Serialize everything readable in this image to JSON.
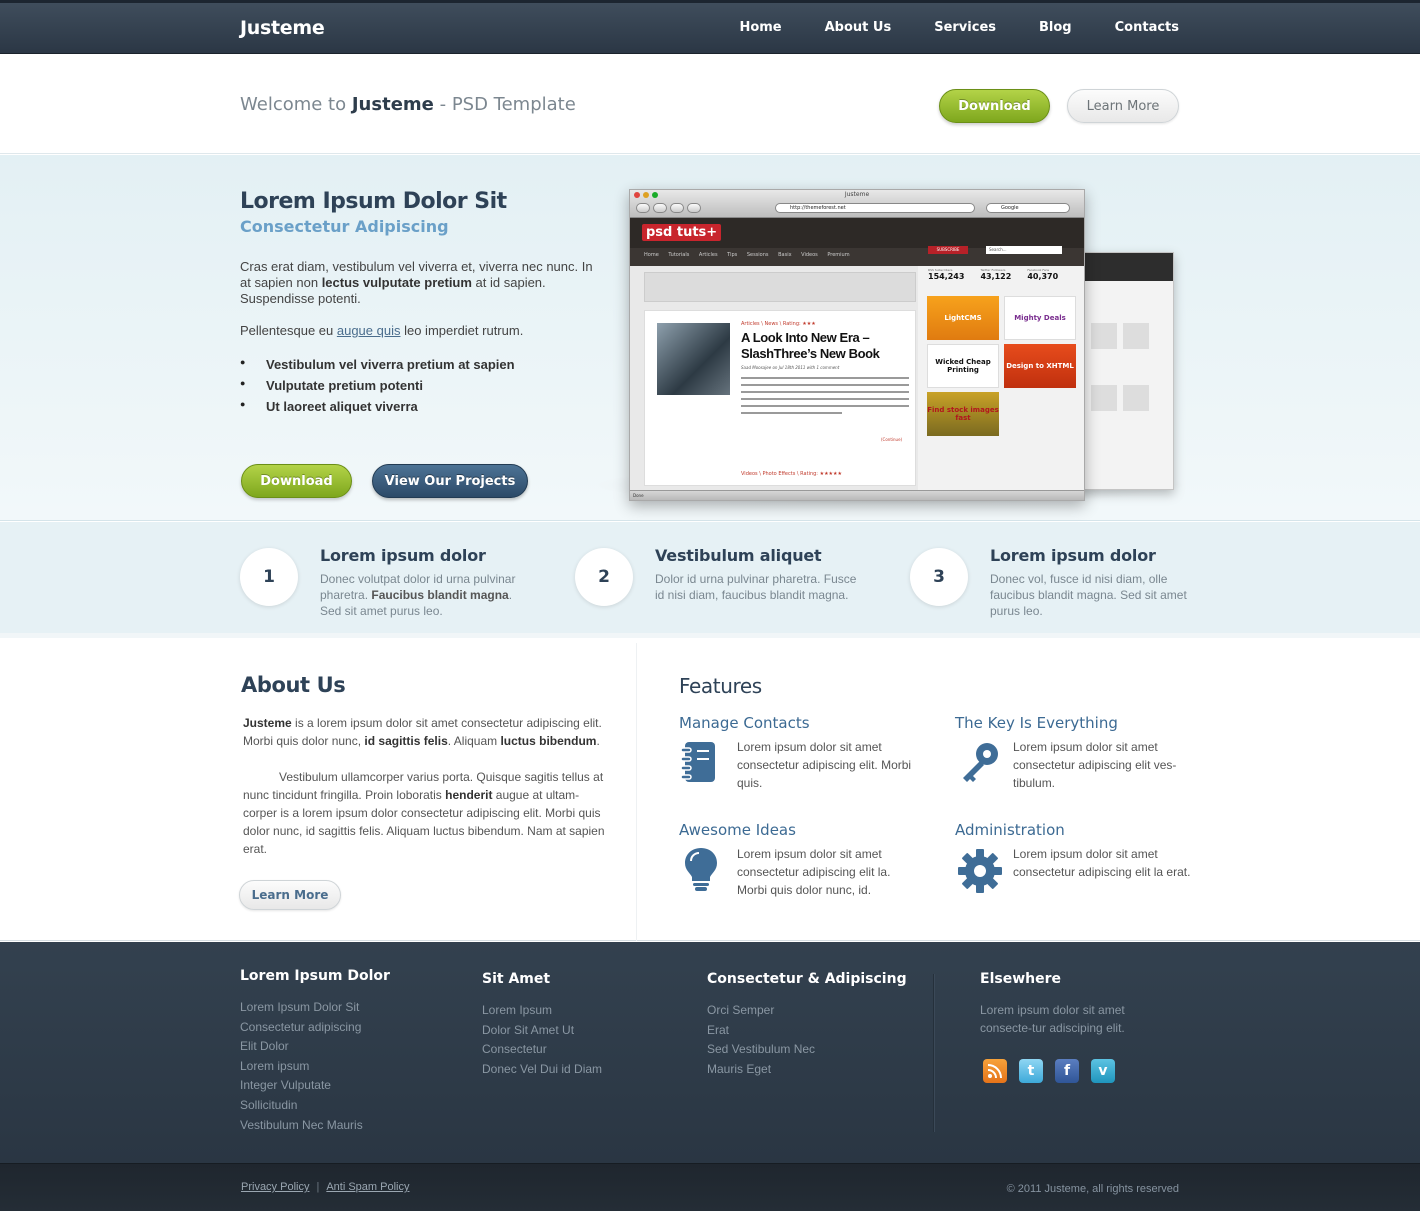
{
  "header": {
    "logo": "Justeme",
    "nav": [
      "Home",
      "About Us",
      "Services",
      "Blog",
      "Contacts"
    ]
  },
  "welcome": {
    "prefix": "Welcome to ",
    "brand": "Justeme",
    "suffix": " - PSD Template",
    "download_label": "Download",
    "learn_more_label": "Learn More"
  },
  "hero": {
    "title": "Lorem Ipsum Dolor Sit",
    "subtitle": "Consectetur Adipiscing",
    "para1_a": "Cras erat diam, vestibulum vel viverra et, viverra nec nunc. In at sapien non ",
    "para1_bold": "lectus vulputate pretium",
    "para1_b": " at id sapien. Suspendisse potenti.",
    "para2_a": "Pellentesque eu ",
    "para2_link": "augue quis",
    "para2_b": " leo imperdiet rutrum.",
    "bullets": [
      "Vestibulum vel viverra pretium at sapien",
      "Vulputate pretium potenti",
      "Ut laoreet aliquet viverra"
    ],
    "download_label": "Download",
    "projects_label": "View Our Projects",
    "mockup": {
      "window_title": "Justeme",
      "url": "http://themeforest.net",
      "search_engine": "Google",
      "site_logo": "psd tuts+",
      "menu": "Home Tutorials Articles Tips Sessions Basix Videos Premium",
      "subscribe": "SUBSCRIBE",
      "search_placeholder": "Search...",
      "stats": [
        {
          "label": "RSS Subscribers",
          "value": "154,243"
        },
        {
          "label": "Twitter Followers",
          "value": "43,122"
        },
        {
          "label": "Facebook Fans",
          "value": "40,370"
        }
      ],
      "article_meta": "Articles \\ News \\ Rating: ★★★",
      "article_title": "A Look Into New Era – SlashThree’s New Book",
      "article_byline": "Saad Moosajee on Jul 18th 2011 with 1 comment",
      "continue": "(Continue)",
      "article2_meta": "Videos \\ Photo Effects \\ Rating: ★★★★★",
      "ads": [
        "LightCMS",
        "Mighty Deals",
        "Wicked Cheap Printing",
        "Design to XHTML",
        "Find stock images fast"
      ],
      "status": "Done"
    }
  },
  "steps": [
    {
      "num": "1",
      "title": "Lorem ipsum dolor",
      "text_a": "Donec volutpat dolor id urna pulvinar pharetra. ",
      "text_bold": "Faucibus blandit magna",
      "text_b": ". Sed sit amet purus leo."
    },
    {
      "num": "2",
      "title": "Vestibulum aliquet",
      "text_a": "Dolor id urna pulvinar pharetra. Fusce id nisi diam, faucibus blandit magna.",
      "text_bold": "",
      "text_b": ""
    },
    {
      "num": "3",
      "title": "Lorem ipsum dolor",
      "text_a": "Donec vol, fusce id nisi diam, olle faucibus blandit magna. Sed sit amet purus leo.",
      "text_bold": "",
      "text_b": ""
    }
  ],
  "about": {
    "title": "About Us",
    "p1_b1": "Justeme",
    "p1_a": " is a lorem ipsum dolor sit amet consectetur adipiscing elit. Morbi quis dolor nunc, ",
    "p1_b2": "id sagittis felis",
    "p1_c": ". Aliquam ",
    "p1_b3": "luctus bibendum",
    "p1_d": ".",
    "p2_a": "Vestibulum ullamcorper varius porta. Quisque sagitis tellus at nunc tincidunt fringilla. Proin loboratis ",
    "p2_b": "henderit",
    "p2_c": " augue at ultam-corper is a lorem ipsum dolor consectetur adipiscing elit. Morbi quis dolor nunc, id sagittis felis. Aliquam luctus bibendum. Nam at sapien erat.",
    "learn_more_label": "Learn More"
  },
  "features": {
    "title": "Features",
    "items": [
      {
        "title": "Manage Contacts",
        "icon": "notebook-icon",
        "text": "Lorem ipsum dolor sit amet consectetur adipiscing elit. Morbi quis."
      },
      {
        "title": "The Key Is Everything",
        "icon": "key-icon",
        "text": "Lorem ipsum dolor sit amet consectetur adipiscing elit ves-tibulum."
      },
      {
        "title": "Awesome Ideas",
        "icon": "lightbulb-icon",
        "text": "Lorem ipsum dolor sit amet consectetur adipiscing elit la. Morbi quis dolor nunc, id."
      },
      {
        "title": "Administration",
        "icon": "gear-icon",
        "text": "Lorem ipsum dolor sit amet consectetur adipiscing elit la erat."
      }
    ]
  },
  "footer": {
    "col1": {
      "title": "Lorem Ipsum Dolor",
      "links": [
        "Lorem Ipsum Dolor Sit",
        "Consectetur adipiscing",
        "Elit Dolor",
        "Lorem ipsum",
        "Integer Vulputate",
        "Sollicitudin",
        "Vestibulum Nec Mauris"
      ]
    },
    "col2": {
      "title": "Sit Amet",
      "links": [
        "Lorem Ipsum",
        "Dolor Sit Amet Ut",
        "Consectetur",
        "Donec Vel Dui id Diam"
      ]
    },
    "col3": {
      "title": "Consectetur & Adipiscing",
      "links": [
        "Orci Semper",
        "Erat",
        "Sed Vestibulum Nec",
        "Mauris Eget"
      ]
    },
    "col4": {
      "title": "Elsewhere",
      "text": "Lorem ipsum dolor sit amet consecte-tur adisciping elit.",
      "social": [
        "rss-icon",
        "twitter-icon",
        "facebook-icon",
        "vimeo-icon"
      ]
    },
    "privacy": "Privacy Policy",
    "antispam": "Anti Spam Policy",
    "copyright": "© 2011 Justeme, all rights reserved"
  },
  "colors": {
    "header_bg": "#2f3c4a",
    "green_button": "#8cb52a",
    "blue_button": "#36587a",
    "heading": "#2e4257",
    "feature_accent": "#3c6a93",
    "footer_bg": "#2f3c4a"
  }
}
